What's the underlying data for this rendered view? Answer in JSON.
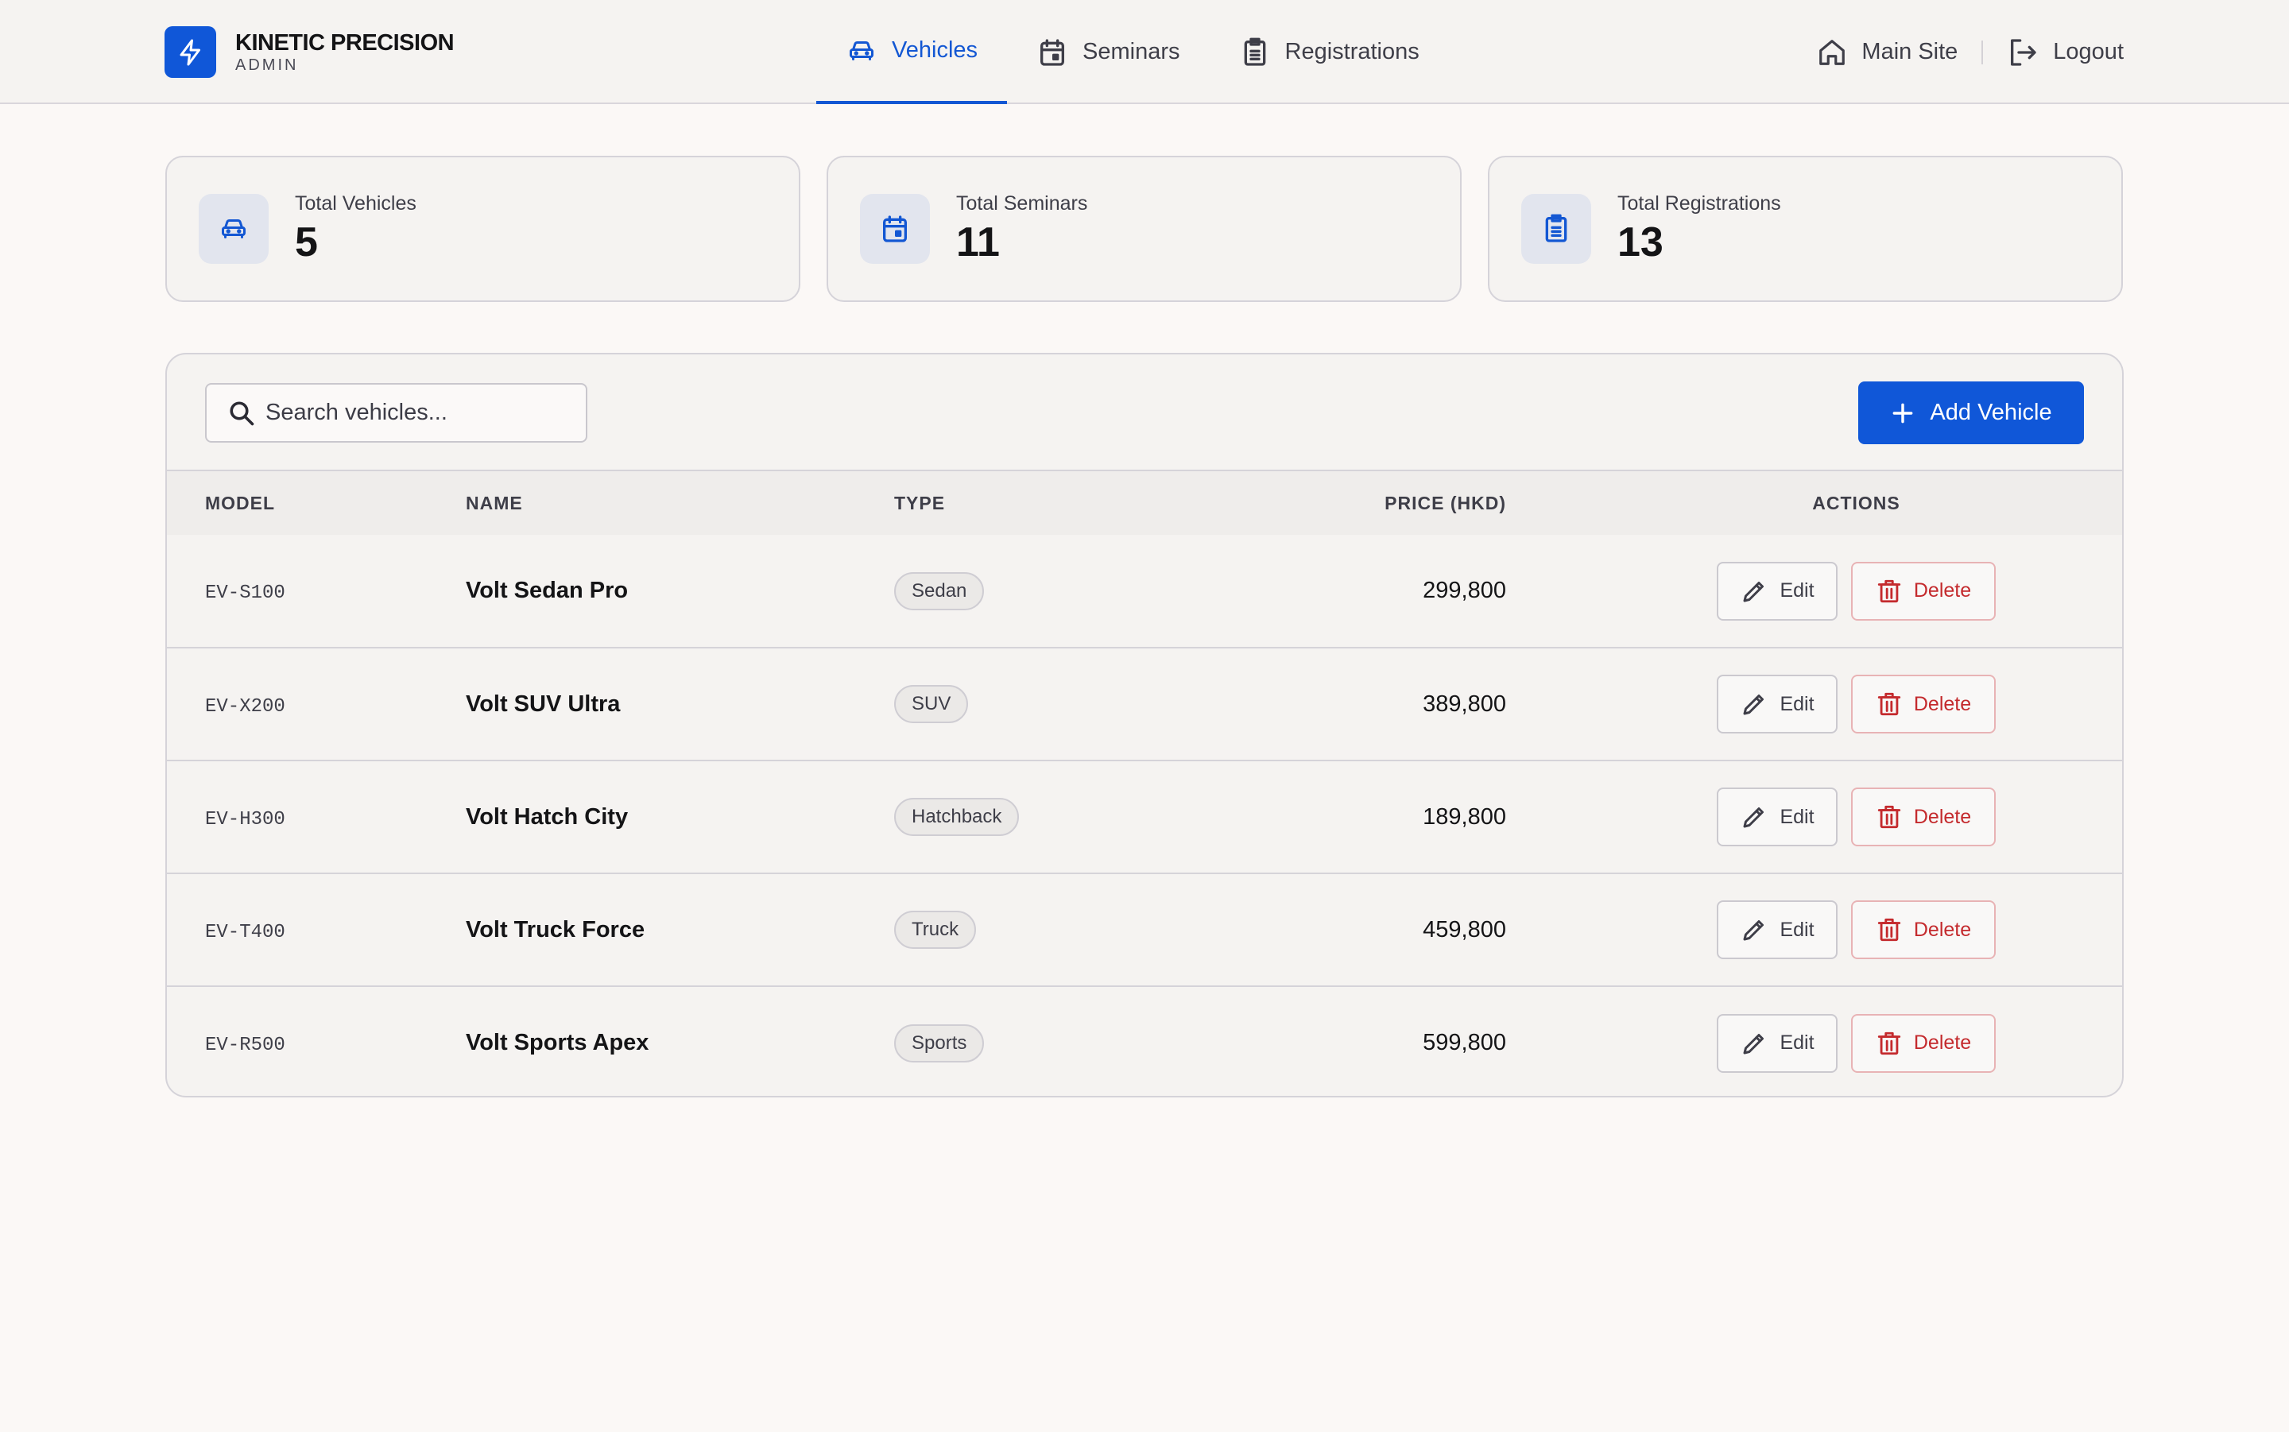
{
  "brand": {
    "name": "KINETIC PRECISION",
    "subtitle": "ADMIN",
    "accent": "#1057d8"
  },
  "nav": {
    "items": [
      {
        "label": "Vehicles",
        "icon": "car-icon",
        "active": true
      },
      {
        "label": "Seminars",
        "icon": "calendar-icon",
        "active": false
      },
      {
        "label": "Registrations",
        "icon": "clipboard-icon",
        "active": false
      }
    ],
    "main_site": "Main Site",
    "logout": "Logout"
  },
  "stats": [
    {
      "label": "Total Vehicles",
      "value": "5",
      "icon": "car-icon"
    },
    {
      "label": "Total Seminars",
      "value": "11",
      "icon": "calendar-icon"
    },
    {
      "label": "Total Registrations",
      "value": "13",
      "icon": "clipboard-icon"
    }
  ],
  "toolbar": {
    "search_placeholder": "Search vehicles...",
    "add_label": "Add Vehicle"
  },
  "table": {
    "headers": {
      "model": "MODEL",
      "name": "NAME",
      "type": "TYPE",
      "price": "PRICE (HKD)",
      "actions": "ACTIONS"
    },
    "rows": [
      {
        "model": "EV-S100",
        "name": "Volt Sedan Pro",
        "type": "Sedan",
        "price": "299,800"
      },
      {
        "model": "EV-X200",
        "name": "Volt SUV Ultra",
        "type": "SUV",
        "price": "389,800"
      },
      {
        "model": "EV-H300",
        "name": "Volt Hatch City",
        "type": "Hatchback",
        "price": "189,800"
      },
      {
        "model": "EV-T400",
        "name": "Volt Truck Force",
        "type": "Truck",
        "price": "459,800"
      },
      {
        "model": "EV-R500",
        "name": "Volt Sports Apex",
        "type": "Sports",
        "price": "599,800"
      }
    ],
    "edit_label": "Edit",
    "delete_label": "Delete"
  }
}
